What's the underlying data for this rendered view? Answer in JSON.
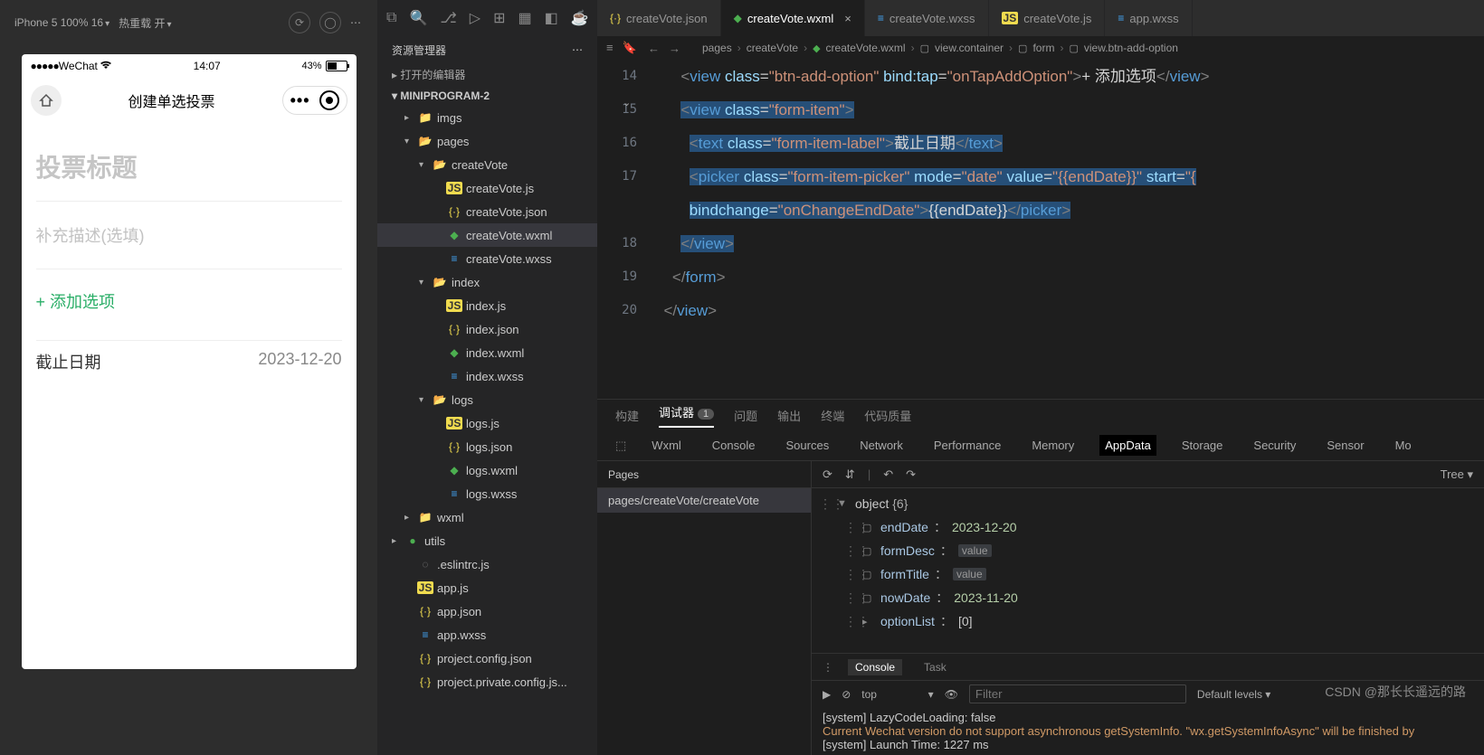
{
  "simulator": {
    "device": "iPhone 5 100% 16",
    "hotReload": "热重载 开",
    "statusbar": {
      "carrier": "WeChat",
      "time": "14:07",
      "battery": "43%"
    },
    "nav": {
      "title": "创建单选投票"
    },
    "form": {
      "titlePlaceholder": "投票标题",
      "descPlaceholder": "补充描述(选填)",
      "addOption": "+ 添加选项",
      "endDateLabel": "截止日期",
      "endDateValue": "2023-12-20"
    }
  },
  "explorer": {
    "title": "资源管理器",
    "openEditors": "打开的编辑器",
    "project": "MINIPROGRAM-2",
    "tree": [
      {
        "d": 1,
        "caret": "▸",
        "ico": "folder",
        "label": "imgs"
      },
      {
        "d": 1,
        "caret": "▾",
        "ico": "folder-open",
        "label": "pages"
      },
      {
        "d": 2,
        "caret": "▾",
        "ico": "folder-open",
        "label": "createVote"
      },
      {
        "d": 3,
        "caret": "",
        "ico": "js",
        "label": "createVote.js"
      },
      {
        "d": 3,
        "caret": "",
        "ico": "json",
        "label": "createVote.json"
      },
      {
        "d": 3,
        "caret": "",
        "ico": "wxml",
        "label": "createVote.wxml",
        "active": true
      },
      {
        "d": 3,
        "caret": "",
        "ico": "wxss",
        "label": "createVote.wxss"
      },
      {
        "d": 2,
        "caret": "▾",
        "ico": "folder-open",
        "label": "index"
      },
      {
        "d": 3,
        "caret": "",
        "ico": "js",
        "label": "index.js"
      },
      {
        "d": 3,
        "caret": "",
        "ico": "json",
        "label": "index.json"
      },
      {
        "d": 3,
        "caret": "",
        "ico": "wxml",
        "label": "index.wxml"
      },
      {
        "d": 3,
        "caret": "",
        "ico": "wxss",
        "label": "index.wxss"
      },
      {
        "d": 2,
        "caret": "▾",
        "ico": "folder-open",
        "label": "logs"
      },
      {
        "d": 3,
        "caret": "",
        "ico": "js",
        "label": "logs.js"
      },
      {
        "d": 3,
        "caret": "",
        "ico": "json",
        "label": "logs.json"
      },
      {
        "d": 3,
        "caret": "",
        "ico": "wxml",
        "label": "logs.wxml"
      },
      {
        "d": 3,
        "caret": "",
        "ico": "wxss",
        "label": "logs.wxss"
      },
      {
        "d": 1,
        "caret": "▸",
        "ico": "folder",
        "label": "wxml"
      },
      {
        "d": 0,
        "caret": "▸",
        "ico": "dot",
        "label": "utils"
      },
      {
        "d": 1,
        "caret": "",
        "ico": "misc",
        "label": ".eslintrc.js"
      },
      {
        "d": 1,
        "caret": "",
        "ico": "js",
        "label": "app.js"
      },
      {
        "d": 1,
        "caret": "",
        "ico": "json",
        "label": "app.json"
      },
      {
        "d": 1,
        "caret": "",
        "ico": "wxss",
        "label": "app.wxss"
      },
      {
        "d": 1,
        "caret": "",
        "ico": "json",
        "label": "project.config.json"
      },
      {
        "d": 1,
        "caret": "",
        "ico": "json",
        "label": "project.private.config.js..."
      }
    ]
  },
  "tabs": [
    {
      "ico": "json",
      "label": "createVote.json"
    },
    {
      "ico": "wxml",
      "label": "createVote.wxml",
      "active": true,
      "close": true
    },
    {
      "ico": "wxss",
      "label": "createVote.wxss"
    },
    {
      "ico": "js",
      "label": "createVote.js"
    },
    {
      "ico": "wxss",
      "label": "app.wxss"
    }
  ],
  "breadcrumb": [
    "pages",
    "createVote",
    "createVote.wxml",
    "view.container",
    "form",
    "view.btn-add-option"
  ],
  "code": {
    "startLine": 14,
    "lines": [
      {
        "indent": 3,
        "sel": false,
        "html": "<span class='tk-bracket'>&lt;</span><span class='tk-tag'>view</span> <span class='tk-attr'>class</span>=<span class='tk-str'>\"btn-add-option\"</span> <span class='tk-attr'>bind:tap</span>=<span class='tk-str'>\"onTapAddOption\"</span><span class='tk-bracket'>&gt;</span><span class='tk-txt'>+ 添加选项</span><span class='tk-bracket'>&lt;/</span><span class='tk-tag'>view</span><span class='tk-bracket'>&gt;</span>"
      },
      {
        "indent": 3,
        "sel": true,
        "html": "<span class='tk-bracket'>&lt;</span><span class='tk-tag'>view</span> <span class='tk-attr'>class</span>=<span class='tk-str'>\"form-item\"</span><span class='tk-bracket'>&gt;</span>"
      },
      {
        "indent": 4,
        "sel": true,
        "html": "<span class='tk-bracket'>&lt;</span><span class='tk-tag'>text</span> <span class='tk-attr'>class</span>=<span class='tk-str'>\"form-item-label\"</span><span class='tk-bracket'>&gt;</span><span class='tk-txt'>截止日期</span><span class='tk-bracket'>&lt;/</span><span class='tk-tag'>text</span><span class='tk-bracket'>&gt;</span>"
      },
      {
        "indent": 4,
        "sel": true,
        "html": "<span class='tk-bracket'>&lt;</span><span class='tk-tag'>picker</span> <span class='tk-attr'>class</span>=<span class='tk-str'>\"form-item-picker\"</span> <span class='tk-attr'>mode</span>=<span class='tk-str'>\"date\"</span> <span class='tk-attr'>value</span>=<span class='tk-str'>\"{{endDate}}\"</span> <span class='tk-attr'>start</span>=<span class='tk-str'>\"{</span>"
      },
      {
        "indent": 4,
        "sel": true,
        "cont": true,
        "html": "<span class='tk-attr'>bindchange</span>=<span class='tk-str'>\"onChangeEndDate\"</span><span class='tk-bracket'>&gt;</span><span class='tk-txt'>{{endDate}}</span><span class='tk-bracket'>&lt;/</span><span class='tk-tag'>picker</span><span class='tk-bracket'>&gt;</span>"
      },
      {
        "indent": 3,
        "sel": true,
        "html": "<span class='tk-bracket'>&lt;/</span><span class='tk-tag'>view</span><span class='tk-bracket'>&gt;</span>"
      },
      {
        "indent": 2,
        "sel": false,
        "html": "<span class='tk-bracket'>&lt;/</span><span class='tk-tag'>form</span><span class='tk-bracket'>&gt;</span>"
      },
      {
        "indent": 1,
        "sel": false,
        "html": "<span class='tk-bracket'>&lt;/</span><span class='tk-tag'>view</span><span class='tk-bracket'>&gt;</span>"
      }
    ]
  },
  "devtools": {
    "tabs1": [
      "构建",
      "调试器",
      "问题",
      "输出",
      "终端",
      "代码质量"
    ],
    "tabs1ActiveIndex": 1,
    "tabs1Badge": "1",
    "tabs2": [
      "Wxml",
      "Console",
      "Sources",
      "Network",
      "Performance",
      "Memory",
      "AppData",
      "Storage",
      "Security",
      "Sensor",
      "Mo"
    ],
    "tabs2Active": "AppData",
    "pagesTitle": "Pages",
    "pagePath": "pages/createVote/createVote",
    "treeLabel": "Tree",
    "appData": {
      "root": "object",
      "rootCount": "{6}",
      "rows": [
        {
          "key": "endDate",
          "val": "2023-12-20",
          "type": "str"
        },
        {
          "key": "formDesc",
          "val": "value",
          "type": "placeholder"
        },
        {
          "key": "formTitle",
          "val": "value",
          "type": "placeholder"
        },
        {
          "key": "nowDate",
          "val": "2023-11-20",
          "type": "str"
        },
        {
          "key": "optionList",
          "val": "[0]",
          "type": "obj",
          "expand": true
        }
      ]
    },
    "consoleTabs": [
      "Console",
      "Task"
    ],
    "consoleContext": "top",
    "filterPlaceholder": "Filter",
    "levels": "Default levels",
    "logs": [
      "[system] LazyCodeLoading: false",
      "Current Wechat version do not support asynchronous getSystemInfo. \"wx.getSystemInfoAsync\" will be finished by",
      "[system] Launch Time: 1227 ms"
    ]
  },
  "watermark": "CSDN @那长长遥远的路"
}
